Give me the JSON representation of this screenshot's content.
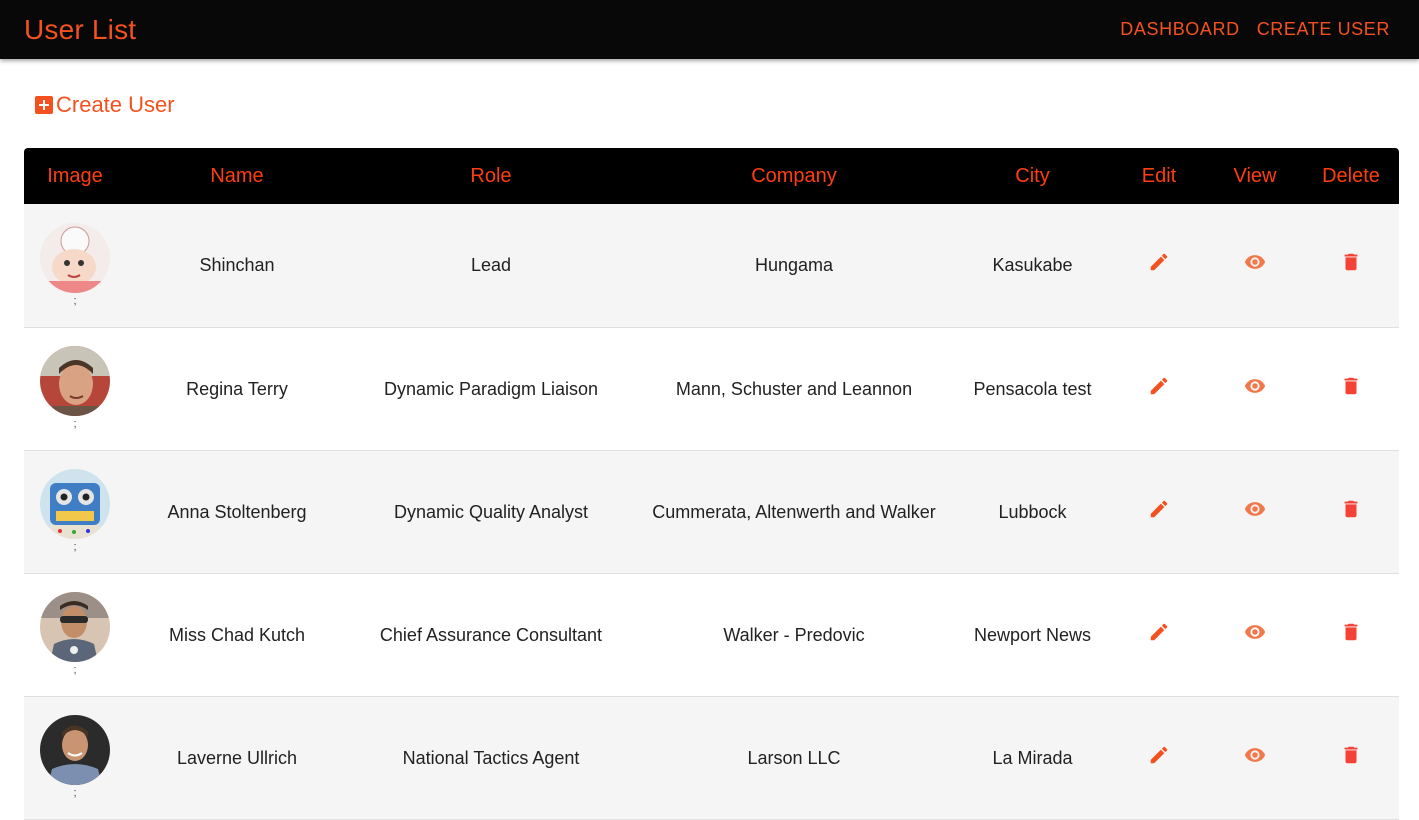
{
  "header": {
    "title": "User List",
    "nav": [
      "DASHBOARD",
      "CREATE USER"
    ]
  },
  "create_link": {
    "label": "Create User",
    "icon": "add-box-icon"
  },
  "table": {
    "columns": [
      "Image",
      "Name",
      "Role",
      "Company",
      "City",
      "Edit",
      "View",
      "Delete"
    ],
    "rows": [
      {
        "image_caption": ";",
        "name": "Shinchan",
        "role": "Lead",
        "company": "Hungama",
        "city": "Kasukabe"
      },
      {
        "image_caption": ";",
        "name": "Regina Terry",
        "role": "Dynamic Paradigm Liaison",
        "company": "Mann, Schuster and Leannon",
        "city": "Pensacola test"
      },
      {
        "image_caption": ";",
        "name": "Anna Stoltenberg",
        "role": "Dynamic Quality Analyst",
        "company": "Cummerata, Altenwerth and Walker",
        "city": "Lubbock"
      },
      {
        "image_caption": ";",
        "name": "Miss Chad Kutch",
        "role": "Chief Assurance Consultant",
        "company": "Walker - Predovic",
        "city": "Newport News"
      },
      {
        "image_caption": ";",
        "name": "Laverne Ullrich",
        "role": "National Tactics Agent",
        "company": "Larson LLC",
        "city": "La Mirada"
      }
    ],
    "action_icons": {
      "edit": "pencil-icon",
      "view": "eye-icon",
      "delete": "trash-icon"
    }
  },
  "colors": {
    "accent": "#f4511e",
    "header_text": "#ff3d12",
    "appbar_bg": "#080808",
    "edit_icon": "#f4511e",
    "view_icon": "#f2784b",
    "delete_icon": "#f44336",
    "row_odd": "#f5f5f5",
    "row_even": "#ffffff"
  }
}
